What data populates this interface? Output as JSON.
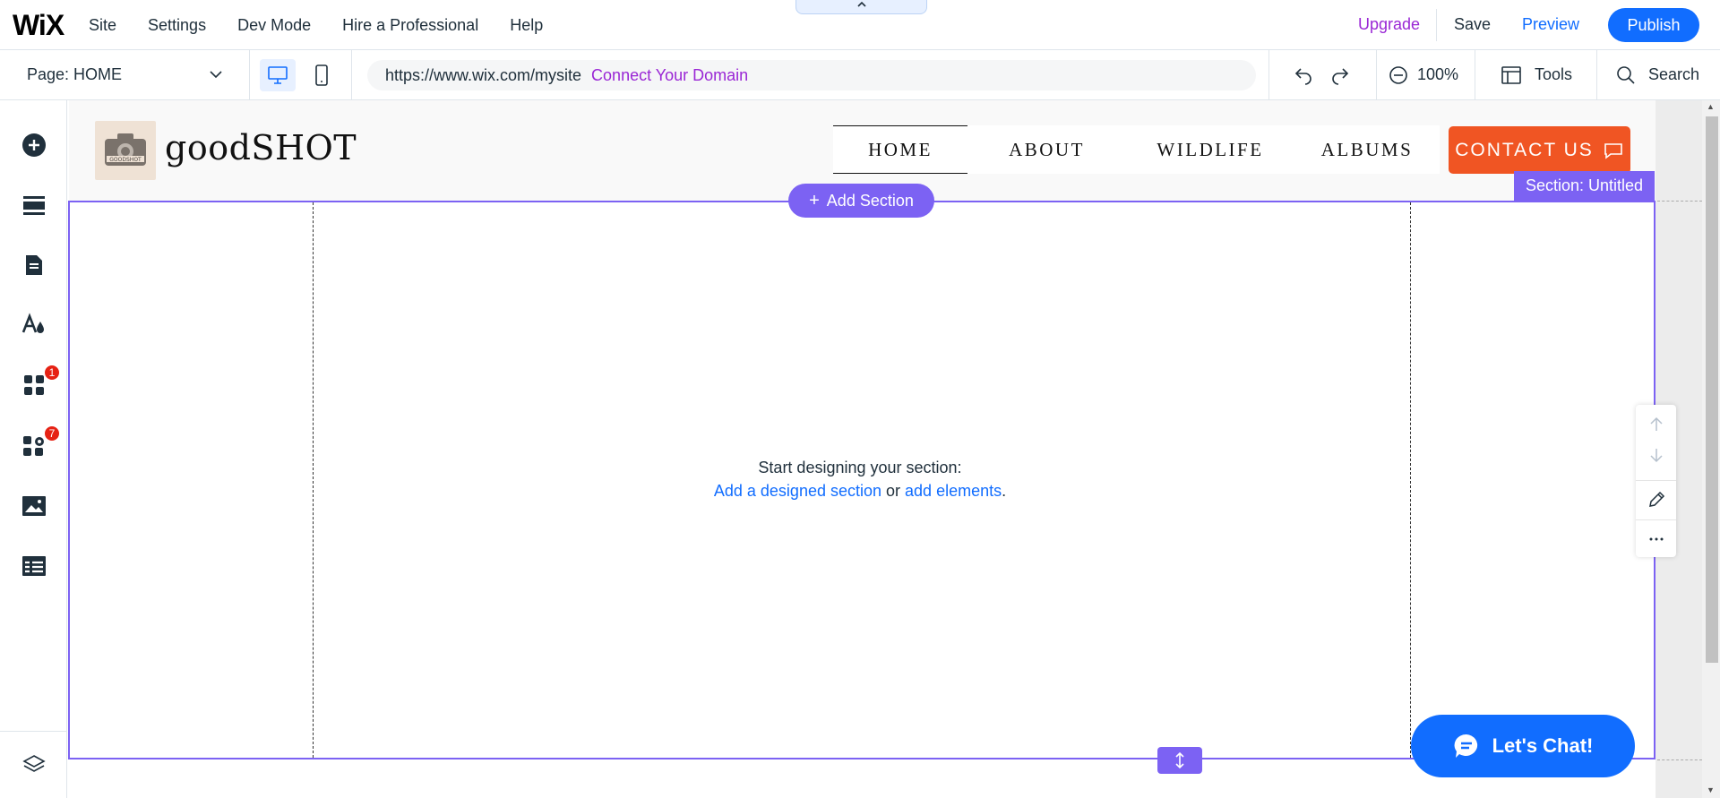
{
  "topbar": {
    "logo": "WiX",
    "menu": [
      "Site",
      "Settings",
      "Dev Mode",
      "Hire a Professional",
      "Help"
    ],
    "handle_icon": "chevron-up-icon",
    "upgrade": "Upgrade",
    "save": "Save",
    "preview": "Preview",
    "publish": "Publish"
  },
  "toolbar": {
    "page_label": "Page: HOME",
    "url": "https://www.wix.com/mysite",
    "connect_domain": "Connect Your Domain",
    "zoom": "100%",
    "tools": "Tools",
    "search": "Search"
  },
  "leftrail": {
    "items": [
      {
        "icon": "add-icon"
      },
      {
        "icon": "sections-icon"
      },
      {
        "icon": "pages-icon"
      },
      {
        "icon": "design-icon"
      },
      {
        "icon": "apps-icon",
        "badge": "1"
      },
      {
        "icon": "business-tools-icon",
        "badge": "7"
      },
      {
        "icon": "media-icon"
      },
      {
        "icon": "cms-icon"
      }
    ],
    "layers_icon": "layers-icon"
  },
  "site": {
    "name": "goodSHOT",
    "logo_text": "GOODSHOT",
    "nav": [
      "HOME",
      "ABOUT",
      "WILDLIFE",
      "ALBUMS"
    ],
    "contact": "CONTACT US"
  },
  "editor": {
    "section_tag": "Section: Untitled",
    "add_section": "Add Section",
    "empty_title": "Start designing your section:",
    "link_designed": "Add a designed section",
    "or_text": " or ",
    "link_elements": "add elements",
    "period": ".",
    "chat": "Let's Chat!"
  },
  "colors": {
    "accent": "#116dff",
    "section": "#7c62f3",
    "contact": "#f05523",
    "upgrade": "#9a27d5",
    "badge": "#e62214"
  }
}
